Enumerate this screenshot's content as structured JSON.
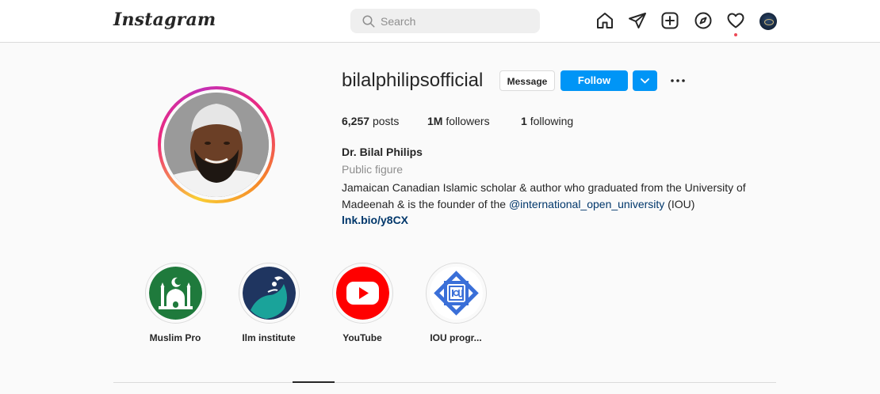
{
  "header": {
    "logo": "Instagram",
    "search": {
      "placeholder": "Search",
      "value": ""
    },
    "nav_icons": [
      "home-icon",
      "direct-message-icon",
      "new-post-icon",
      "explore-icon",
      "activity-heart-icon",
      "profile-avatar"
    ]
  },
  "profile": {
    "username": "bilalphilipsofficial",
    "buttons": {
      "message": "Message",
      "follow": "Follow"
    },
    "stats": [
      {
        "value": "6,257",
        "label": "posts"
      },
      {
        "value": "1M",
        "label": "followers"
      },
      {
        "value": "1",
        "label": "following"
      }
    ],
    "full_name": "Dr. Bilal Philips",
    "category": "Public figure",
    "bio": {
      "line1": "Jamaican Canadian Islamic scholar & author who graduated from the University of",
      "line2_before": "Madeenah & is the founder of the ",
      "mention": "@international_open_university",
      "line2_after": " (IOU)"
    },
    "link": "lnk.bio/y8CX"
  },
  "highlights": [
    {
      "label": "Muslim Pro"
    },
    {
      "label": "Ilm institute"
    },
    {
      "label": "YouTube"
    },
    {
      "label": "IOU progr..."
    }
  ],
  "colors": {
    "accent_blue": "#0095f6",
    "link_blue": "#00376b",
    "youtube_red": "#ff0000",
    "muslimpro_green": "#1f7a3c",
    "ilm_navy": "#1f3560",
    "ilm_teal": "#1aa39a",
    "iou_blue": "#3a6fd8"
  }
}
